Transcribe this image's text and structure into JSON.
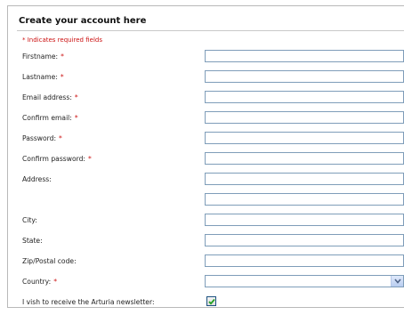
{
  "form": {
    "title": "Create your account here",
    "required_note": "* Indicates required fields",
    "required_marker": "*",
    "fields": [
      {
        "label": "Firstname:",
        "required": true,
        "value": ""
      },
      {
        "label": "Lastname:",
        "required": true,
        "value": ""
      },
      {
        "label": "Email address:",
        "required": true,
        "value": ""
      },
      {
        "label": "Confirm email:",
        "required": true,
        "value": ""
      },
      {
        "label": "Password:",
        "required": true,
        "value": ""
      },
      {
        "label": "Confirm password:",
        "required": true,
        "value": ""
      },
      {
        "label": "Address:",
        "required": false,
        "value": ""
      },
      {
        "label": "",
        "required": false,
        "value": ""
      },
      {
        "label": "City:",
        "required": false,
        "value": ""
      },
      {
        "label": "State:",
        "required": false,
        "value": ""
      },
      {
        "label": "Zip/Postal code:",
        "required": false,
        "value": ""
      }
    ],
    "country": {
      "label": "Country:",
      "required": true,
      "selected": ""
    },
    "newsletter": {
      "label": "I vish to receive the Arturia newsletter:",
      "checked": true
    }
  }
}
